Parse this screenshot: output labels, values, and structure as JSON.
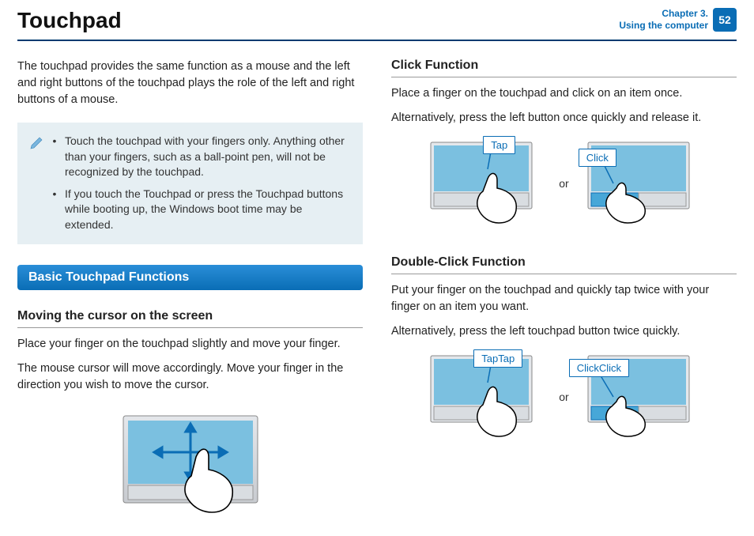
{
  "header": {
    "title": "Touchpad",
    "chapter_line1": "Chapter 3.",
    "chapter_line2": "Using the computer",
    "page_number": "52"
  },
  "left": {
    "intro": "The touchpad provides the same function as a mouse and the left and right buttons of the touchpad plays the role of the left and right buttons of a mouse.",
    "notes": [
      "Touch the touchpad with your fingers only. Anything other than your fingers, such as a ball-point pen, will not be recognized by the touchpad.",
      "If you touch the Touchpad or press the Touchpad buttons while booting up, the Windows boot time may be extended."
    ],
    "section_banner": "Basic Touchpad Functions",
    "sub_head": "Moving the cursor on the screen",
    "p1": "Place your finger on the touchpad slightly and move your finger.",
    "p2": "The mouse cursor will move accordingly. Move your finger in the direction you wish to move the cursor."
  },
  "right": {
    "click": {
      "head": "Click Function",
      "p1": "Place a finger on the touchpad and click on an item once.",
      "p2": "Alternatively, press the left button once quickly and release it.",
      "label_tap": "Tap",
      "label_click": "Click",
      "or": "or"
    },
    "dbl": {
      "head": "Double-Click Function",
      "p1": "Put your finger on the touchpad and quickly tap twice with your finger on an item you want.",
      "p2": "Alternatively, press the left touchpad button twice quickly.",
      "label_tap": "TapTap",
      "label_click": "ClickClick",
      "or": "or"
    }
  }
}
